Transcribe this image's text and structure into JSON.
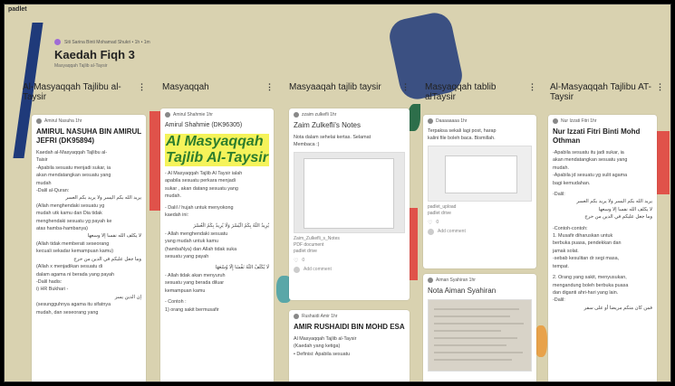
{
  "brand": "padlet",
  "header": {
    "meta": "Siti Sarina Binti Mohamad Shukri • 1h • 1m",
    "title": "Kaedah Fiqh 3",
    "subtitle": "Masyaqqah Tajlib al-Taysir"
  },
  "columns": [
    {
      "title": "Al-Masyaqqah Tajlibu al-Taysir",
      "menu": "⋮"
    },
    {
      "title": "Masyaqqah",
      "menu": "⋮"
    },
    {
      "title": "Masyaaqah tajlib taysir",
      "menu": "⋮"
    },
    {
      "title": "Masyaqqah tablib alTaysir",
      "menu": "⋮"
    },
    {
      "title": "Al-Masyaqqah Tajlibu AT-Taysir",
      "menu": "⋮"
    }
  ],
  "cards": {
    "c1": {
      "author": "Amirul Nasuha  1hr",
      "title": "AMIRUL NASUHA BIN AMIRUL JEFRI (DK95894)",
      "lines": [
        "Kaedah al-Masyaqqah Tajlibu al-",
        "Taisir",
        "-Apabila sesuatu menjadi sukar, ia",
        "akan mendatangkan sesuatu yang",
        "mudah",
        "-Dalil al-Quran:",
        "يريد الله بكم اليسر ولا يريد بكم العسر",
        "(Allah menghendaki sesuatu yg",
        "mudah utk kamu dan Dia tidak",
        "menghendaki sesuatu yg payah ke",
        "atas hamba-hambanya)",
        "لا يكلف الله نفسا إلا وسعها",
        "(Allah tidak memberati seseorang",
        "kecuali sekadar kemampuan kamu)",
        "وما جعل عليكم في الدين من حرج",
        "(Allah x menjadikan sesuatu di",
        "dalam agama ni berada yang payah",
        "-Dalil hadis:",
        "i) HR Bukhari -",
        "إن الدين يسر",
        "(sesungguhnya agama itu sifatnya",
        "mudah, dan seseorang yang"
      ]
    },
    "c2": {
      "author": "Amirul Shahmie  1hr",
      "title": "Amirul Shahmie (DK96305)",
      "highlight": "Al Masyaqqah Tajlib Al-Taysir",
      "lines": [
        "- Al Masyaqqah Tajlib Al Taysir ialah",
        "apabila sesuatu perkara menjadi",
        "sukar , akan datang sesuatu yang",
        "mudah.",
        "",
        "- Dalil / hujah untuk menyokong",
        "kaedah ini:",
        "",
        "يُرِيدُ اللَّهُ بِكُمُ الْيُسْرَ وَلَا يُرِيدُ بِكُمُ الْعُسْرَ",
        "- Allah menghendaki sesuatu",
        "yang mudah untuk kamu",
        "(hambaNya) dan Allah tidak suka",
        "sesuatu yang payah",
        "",
        "لَا يُكَلِّفُ اللَّهُ نَفْسًا إِلَّا وُسْعَهَا",
        "- Allah tidak akan menyuruh",
        "sesuatu yang berada diluar",
        "kemampuan kamu",
        "",
        "- Contoh :",
        "1) orang sakit bermusafir"
      ]
    },
    "c3": {
      "author": "zzaim zulkefli  1hr",
      "title": "Zaim Zulkefli's Notes",
      "lines": [
        "Nota dalam sehelai kertas. Selamat",
        "Membaca :)"
      ],
      "file": "Zaim_Zulkefli_s_Notes",
      "filetype": "PDF document",
      "filesrc": "padlet drive",
      "likes": "0",
      "comment": "Add comment"
    },
    "c4": {
      "author": "Rushaidi Amir  1hr",
      "title": "AMIR RUSHAIDI BIN MOHD ESA",
      "lines": [
        "Al Masyaqqah Tajlib al-Taysir",
        "(Kaedah yang ketiga)",
        "• Definisi: Apabila sesuatu"
      ]
    },
    "c5": {
      "author": "Daaaaaaaa  1hr",
      "lines": [
        "Terpaksa sekali lagi post, harap",
        "kalini file boleh baca. Bismillah."
      ],
      "file": "padlet_upload",
      "filesrc": "padlet drive",
      "likes": "0",
      "comment": "Add comment"
    },
    "c6": {
      "author": "Aiman Syahiran  1hr",
      "title": "Nota Aiman Syahiran"
    },
    "c7": {
      "author": "Nur Izzati Fitri  1hr",
      "title": "Nur Izzati Fitri Binti Mohd Othman",
      "lines": [
        "-Apabila sesuatu itu jadi sukar, ia",
        "akan mendatangkan sesuatu yang",
        "mudah.",
        "-Apabila jd sesuatu yg sulit agama",
        "bagi kemudahan.",
        "",
        "-Dalil:",
        "يريد الله بكم اليسر ولا يريد بكم العسر",
        "لا يكلف الله نفسا إلا وسعها",
        "وما جعل عليكم في الدين من حرج",
        "",
        "-Contoh-contoh:",
        "1. Musafir diharuskan untuk",
        "berbuka puasa, pendekkan dan",
        "jamak solat.",
        "-sebab kesulitan dr segi masa,",
        "tempat.",
        "",
        "2. Orang yang sakit, menyusukan,",
        "mengandung boleh berbuka puasa",
        "dan diganti ahri-hari yang lain.",
        "-Dalil:",
        "فمن كان منكم مريضا أو على سفر"
      ]
    }
  },
  "colors": {
    "background": "#d9d2b0",
    "card": "#ffffff",
    "highlight": "#f5f35a",
    "deco_red": "#e0524a",
    "deco_blue": "#1f3a7a",
    "deco_green": "#2d6e4a"
  }
}
